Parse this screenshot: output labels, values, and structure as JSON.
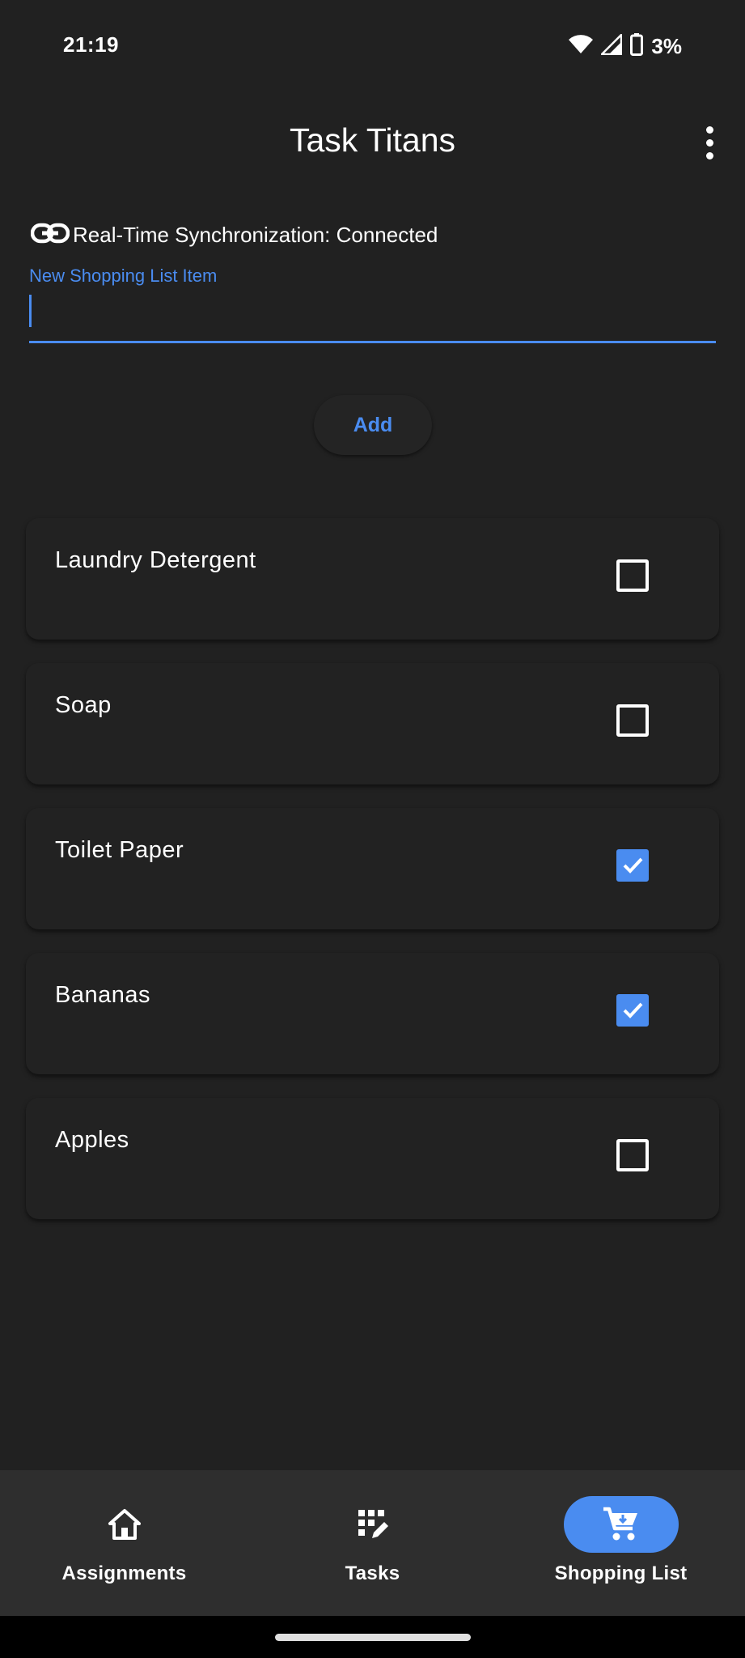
{
  "status_bar": {
    "time": "21:19",
    "battery": "3%",
    "icons": [
      "wifi-icon",
      "cell-signal-icon",
      "battery-icon"
    ]
  },
  "app_bar": {
    "title": "Task Titans",
    "menu_icon": "more-vert-icon"
  },
  "sync": {
    "icon": "link-icon",
    "text": "Real-Time Synchronization: Connected"
  },
  "new_item": {
    "label": "New Shopping List Item",
    "value": ""
  },
  "add_button": {
    "label": "Add"
  },
  "shopping_items": [
    {
      "label": "Laundry Detergent",
      "checked": false
    },
    {
      "label": "Soap",
      "checked": false
    },
    {
      "label": "Toilet Paper",
      "checked": true
    },
    {
      "label": "Bananas",
      "checked": true
    },
    {
      "label": "Apples",
      "checked": false
    }
  ],
  "bottom_nav": {
    "items": [
      {
        "label": "Assignments",
        "icon": "home-icon",
        "active": false
      },
      {
        "label": "Tasks",
        "icon": "tasks-grid-icon",
        "active": false
      },
      {
        "label": "Shopping List",
        "icon": "cart-icon",
        "active": true
      }
    ]
  },
  "colors": {
    "background": "#212121",
    "accent": "#4a8cf0",
    "nav_background": "#2e2e2e"
  }
}
